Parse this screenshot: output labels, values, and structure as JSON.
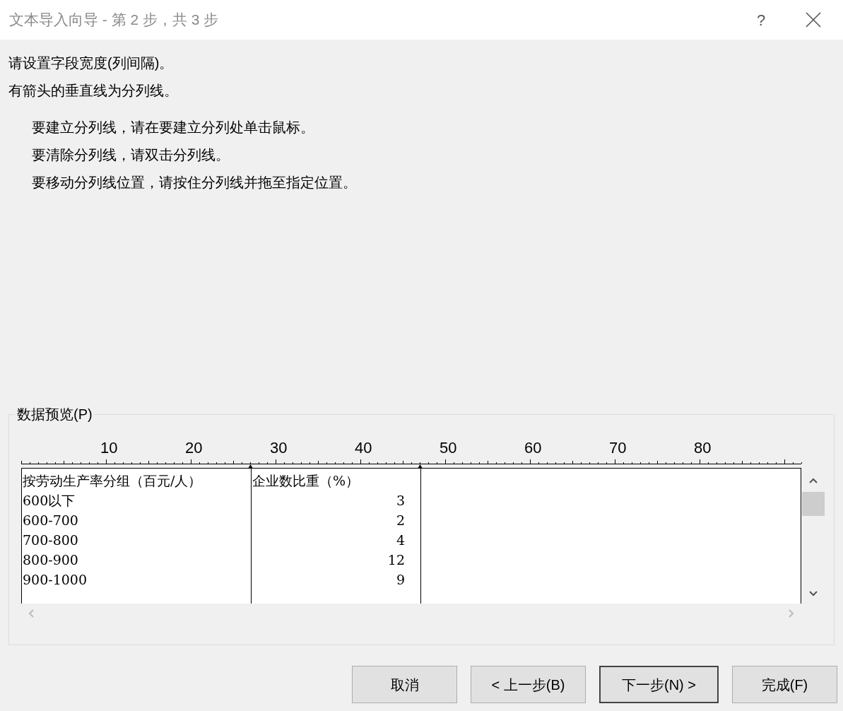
{
  "window": {
    "title": "文本导入向导 - 第 2 步，共 3 步",
    "help": "?"
  },
  "instructions": [
    "请设置字段宽度(列间隔)。",
    "有箭头的垂直线为分列线。"
  ],
  "tips": [
    "要建立分列线，请在要建立分列处单击鼠标。",
    "要清除分列线，请双击分列线。",
    "要移动分列线位置，请按住分列线并拖至指定位置。"
  ],
  "preview": {
    "title": "数据预览(P)",
    "ruler_labels": [
      "10",
      "20",
      "30",
      "40",
      "50",
      "60",
      "70",
      "80"
    ],
    "rows": [
      [
        "按劳动生产率分组（百元/人）",
        "企业数比重（%）"
      ],
      [
        "600以下",
        "3"
      ],
      [
        "600-700",
        "2"
      ],
      [
        "700-800",
        "4"
      ],
      [
        "800-900",
        "12"
      ],
      [
        "900-1000",
        "9"
      ]
    ]
  },
  "buttons": [
    {
      "label": "取消",
      "default": false
    },
    {
      "label": "< 上一步(B)",
      "default": false
    },
    {
      "label": "下一步(N) >",
      "default": true
    },
    {
      "label": "完成(F)",
      "default": false
    }
  ]
}
